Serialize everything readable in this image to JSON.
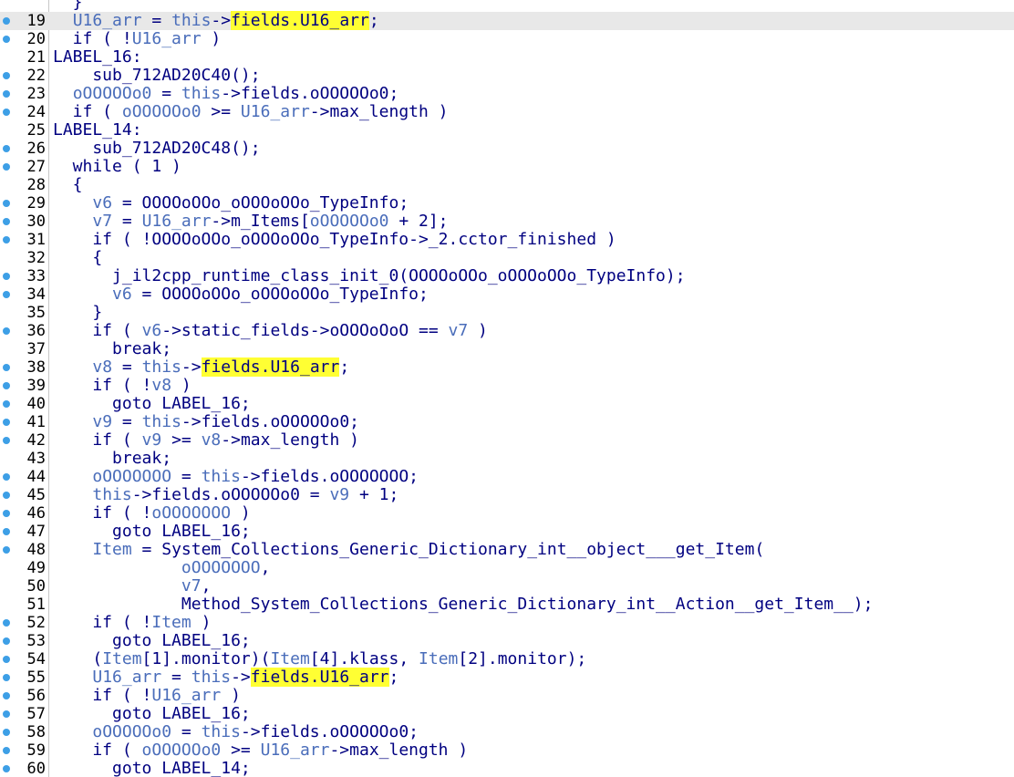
{
  "editor": {
    "lines": [
      {
        "n": "",
        "bp": false,
        "current": false,
        "tokens": [
          {
            "t": "  }",
            "c": ""
          }
        ]
      },
      {
        "n": "19",
        "bp": true,
        "current": true,
        "tokens": [
          {
            "t": "  ",
            "c": ""
          },
          {
            "t": "U16_arr",
            "c": "var"
          },
          {
            "t": " = ",
            "c": ""
          },
          {
            "t": "this",
            "c": "var"
          },
          {
            "t": "->",
            "c": ""
          },
          {
            "t": "fields.U16_",
            "c": "hl"
          },
          {
            "t": "|",
            "c": "cursor"
          },
          {
            "t": "arr",
            "c": "hl"
          },
          {
            "t": ";",
            "c": ""
          }
        ]
      },
      {
        "n": "20",
        "bp": true,
        "current": false,
        "tokens": [
          {
            "t": "  if ( !",
            "c": ""
          },
          {
            "t": "U16_arr",
            "c": "var"
          },
          {
            "t": " )",
            "c": ""
          }
        ]
      },
      {
        "n": "21",
        "bp": false,
        "current": false,
        "tokens": [
          {
            "t": "LABEL_16:",
            "c": ""
          }
        ]
      },
      {
        "n": "22",
        "bp": true,
        "current": false,
        "tokens": [
          {
            "t": "    sub_712AD20C40();",
            "c": ""
          }
        ]
      },
      {
        "n": "23",
        "bp": true,
        "current": false,
        "tokens": [
          {
            "t": "  ",
            "c": ""
          },
          {
            "t": "oOOOOOo0",
            "c": "var"
          },
          {
            "t": " = ",
            "c": ""
          },
          {
            "t": "this",
            "c": "var"
          },
          {
            "t": "->fields.oOOOOOo0;",
            "c": ""
          }
        ]
      },
      {
        "n": "24",
        "bp": true,
        "current": false,
        "tokens": [
          {
            "t": "  if ( ",
            "c": ""
          },
          {
            "t": "oOOOOOo0",
            "c": "var"
          },
          {
            "t": " >= ",
            "c": ""
          },
          {
            "t": "U16_arr",
            "c": "var"
          },
          {
            "t": "->max_length )",
            "c": ""
          }
        ]
      },
      {
        "n": "25",
        "bp": false,
        "current": false,
        "tokens": [
          {
            "t": "LABEL_14:",
            "c": ""
          }
        ]
      },
      {
        "n": "26",
        "bp": true,
        "current": false,
        "tokens": [
          {
            "t": "    sub_712AD20C48();",
            "c": ""
          }
        ]
      },
      {
        "n": "27",
        "bp": true,
        "current": false,
        "tokens": [
          {
            "t": "  while ( 1 )",
            "c": ""
          }
        ]
      },
      {
        "n": "28",
        "bp": false,
        "current": false,
        "tokens": [
          {
            "t": "  {",
            "c": ""
          }
        ]
      },
      {
        "n": "29",
        "bp": true,
        "current": false,
        "tokens": [
          {
            "t": "    ",
            "c": ""
          },
          {
            "t": "v6",
            "c": "var"
          },
          {
            "t": " = OOOOoOOo_oOOOoOOo_TypeInfo;",
            "c": ""
          }
        ]
      },
      {
        "n": "30",
        "bp": true,
        "current": false,
        "tokens": [
          {
            "t": "    ",
            "c": ""
          },
          {
            "t": "v7",
            "c": "var"
          },
          {
            "t": " = ",
            "c": ""
          },
          {
            "t": "U16_arr",
            "c": "var"
          },
          {
            "t": "->m_Items[",
            "c": ""
          },
          {
            "t": "oOOOOOo0",
            "c": "var"
          },
          {
            "t": " + 2];",
            "c": ""
          }
        ]
      },
      {
        "n": "31",
        "bp": true,
        "current": false,
        "tokens": [
          {
            "t": "    if ( !OOOOoOOo_oOOOoOOo_TypeInfo->_2.cctor_finished )",
            "c": ""
          }
        ]
      },
      {
        "n": "32",
        "bp": false,
        "current": false,
        "tokens": [
          {
            "t": "    {",
            "c": ""
          }
        ]
      },
      {
        "n": "33",
        "bp": true,
        "current": false,
        "tokens": [
          {
            "t": "      j_il2cpp_runtime_class_init_0(OOOOoOOo_oOOOoOOo_TypeInfo);",
            "c": ""
          }
        ]
      },
      {
        "n": "34",
        "bp": true,
        "current": false,
        "tokens": [
          {
            "t": "      ",
            "c": ""
          },
          {
            "t": "v6",
            "c": "var"
          },
          {
            "t": " = OOOOoOOo_oOOOoOOo_TypeInfo;",
            "c": ""
          }
        ]
      },
      {
        "n": "35",
        "bp": false,
        "current": false,
        "tokens": [
          {
            "t": "    }",
            "c": ""
          }
        ]
      },
      {
        "n": "36",
        "bp": true,
        "current": false,
        "tokens": [
          {
            "t": "    if ( ",
            "c": ""
          },
          {
            "t": "v6",
            "c": "var"
          },
          {
            "t": "->static_fields->oOOOoOoO == ",
            "c": ""
          },
          {
            "t": "v7",
            "c": "var"
          },
          {
            "t": " )",
            "c": ""
          }
        ]
      },
      {
        "n": "37",
        "bp": false,
        "current": false,
        "tokens": [
          {
            "t": "      break;",
            "c": ""
          }
        ]
      },
      {
        "n": "38",
        "bp": true,
        "current": false,
        "tokens": [
          {
            "t": "    ",
            "c": ""
          },
          {
            "t": "v8",
            "c": "var"
          },
          {
            "t": " = ",
            "c": ""
          },
          {
            "t": "this",
            "c": "var"
          },
          {
            "t": "->",
            "c": ""
          },
          {
            "t": "fields.U16_arr",
            "c": "hl"
          },
          {
            "t": ";",
            "c": ""
          }
        ]
      },
      {
        "n": "39",
        "bp": true,
        "current": false,
        "tokens": [
          {
            "t": "    if ( !",
            "c": ""
          },
          {
            "t": "v8",
            "c": "var"
          },
          {
            "t": " )",
            "c": ""
          }
        ]
      },
      {
        "n": "40",
        "bp": true,
        "current": false,
        "tokens": [
          {
            "t": "      goto LABEL_16;",
            "c": ""
          }
        ]
      },
      {
        "n": "41",
        "bp": true,
        "current": false,
        "tokens": [
          {
            "t": "    ",
            "c": ""
          },
          {
            "t": "v9",
            "c": "var"
          },
          {
            "t": " = ",
            "c": ""
          },
          {
            "t": "this",
            "c": "var"
          },
          {
            "t": "->fields.oOOOOOo0;",
            "c": ""
          }
        ]
      },
      {
        "n": "42",
        "bp": true,
        "current": false,
        "tokens": [
          {
            "t": "    if ( ",
            "c": ""
          },
          {
            "t": "v9",
            "c": "var"
          },
          {
            "t": " >= ",
            "c": ""
          },
          {
            "t": "v8",
            "c": "var"
          },
          {
            "t": "->max_length )",
            "c": ""
          }
        ]
      },
      {
        "n": "43",
        "bp": false,
        "current": false,
        "tokens": [
          {
            "t": "      break;",
            "c": ""
          }
        ]
      },
      {
        "n": "44",
        "bp": true,
        "current": false,
        "tokens": [
          {
            "t": "    ",
            "c": ""
          },
          {
            "t": "oOOOOOOO",
            "c": "var"
          },
          {
            "t": " = ",
            "c": ""
          },
          {
            "t": "this",
            "c": "var"
          },
          {
            "t": "->fields.oOOOOOOO;",
            "c": ""
          }
        ]
      },
      {
        "n": "45",
        "bp": true,
        "current": false,
        "tokens": [
          {
            "t": "    ",
            "c": ""
          },
          {
            "t": "this",
            "c": "var"
          },
          {
            "t": "->fields.oOOOOOo0 = ",
            "c": ""
          },
          {
            "t": "v9",
            "c": "var"
          },
          {
            "t": " + 1;",
            "c": ""
          }
        ]
      },
      {
        "n": "46",
        "bp": true,
        "current": false,
        "tokens": [
          {
            "t": "    if ( !",
            "c": ""
          },
          {
            "t": "oOOOOOOO",
            "c": "var"
          },
          {
            "t": " )",
            "c": ""
          }
        ]
      },
      {
        "n": "47",
        "bp": true,
        "current": false,
        "tokens": [
          {
            "t": "      goto LABEL_16;",
            "c": ""
          }
        ]
      },
      {
        "n": "48",
        "bp": true,
        "current": false,
        "tokens": [
          {
            "t": "    ",
            "c": ""
          },
          {
            "t": "Item",
            "c": "var"
          },
          {
            "t": " = System_Collections_Generic_Dictionary_int__object___get_Item(",
            "c": ""
          }
        ]
      },
      {
        "n": "49",
        "bp": false,
        "current": false,
        "tokens": [
          {
            "t": "             ",
            "c": ""
          },
          {
            "t": "oOOOOOOO",
            "c": "var"
          },
          {
            "t": ",",
            "c": ""
          }
        ]
      },
      {
        "n": "50",
        "bp": false,
        "current": false,
        "tokens": [
          {
            "t": "             ",
            "c": ""
          },
          {
            "t": "v7",
            "c": "var"
          },
          {
            "t": ",",
            "c": ""
          }
        ]
      },
      {
        "n": "51",
        "bp": false,
        "current": false,
        "tokens": [
          {
            "t": "             Method_System_Collections_Generic_Dictionary_int__Action__get_Item__);",
            "c": ""
          }
        ]
      },
      {
        "n": "52",
        "bp": true,
        "current": false,
        "tokens": [
          {
            "t": "    if ( !",
            "c": ""
          },
          {
            "t": "Item",
            "c": "var"
          },
          {
            "t": " )",
            "c": ""
          }
        ]
      },
      {
        "n": "53",
        "bp": true,
        "current": false,
        "tokens": [
          {
            "t": "      goto LABEL_16;",
            "c": ""
          }
        ]
      },
      {
        "n": "54",
        "bp": true,
        "current": false,
        "tokens": [
          {
            "t": "    (",
            "c": ""
          },
          {
            "t": "Item",
            "c": "var"
          },
          {
            "t": "[1].monitor)(",
            "c": ""
          },
          {
            "t": "Item",
            "c": "var"
          },
          {
            "t": "[4].klass, ",
            "c": ""
          },
          {
            "t": "Item",
            "c": "var"
          },
          {
            "t": "[2].monitor);",
            "c": ""
          }
        ]
      },
      {
        "n": "55",
        "bp": true,
        "current": false,
        "tokens": [
          {
            "t": "    ",
            "c": ""
          },
          {
            "t": "U16_arr",
            "c": "var"
          },
          {
            "t": " = ",
            "c": ""
          },
          {
            "t": "this",
            "c": "var"
          },
          {
            "t": "->",
            "c": ""
          },
          {
            "t": "fields.U16_arr",
            "c": "hl"
          },
          {
            "t": ";",
            "c": ""
          }
        ]
      },
      {
        "n": "56",
        "bp": true,
        "current": false,
        "tokens": [
          {
            "t": "    if ( !",
            "c": ""
          },
          {
            "t": "U16_arr",
            "c": "var"
          },
          {
            "t": " )",
            "c": ""
          }
        ]
      },
      {
        "n": "57",
        "bp": true,
        "current": false,
        "tokens": [
          {
            "t": "      goto LABEL_16;",
            "c": ""
          }
        ]
      },
      {
        "n": "58",
        "bp": true,
        "current": false,
        "tokens": [
          {
            "t": "    ",
            "c": ""
          },
          {
            "t": "oOOOOOo0",
            "c": "var"
          },
          {
            "t": " = ",
            "c": ""
          },
          {
            "t": "this",
            "c": "var"
          },
          {
            "t": "->fields.oOOOOOo0;",
            "c": ""
          }
        ]
      },
      {
        "n": "59",
        "bp": true,
        "current": false,
        "tokens": [
          {
            "t": "    if ( ",
            "c": ""
          },
          {
            "t": "oOOOOOo0",
            "c": "var"
          },
          {
            "t": " >= ",
            "c": ""
          },
          {
            "t": "U16_arr",
            "c": "var"
          },
          {
            "t": "->max_length )",
            "c": ""
          }
        ]
      },
      {
        "n": "60",
        "bp": true,
        "current": false,
        "tokens": [
          {
            "t": "      goto LABEL_14;",
            "c": ""
          }
        ]
      },
      {
        "n": "",
        "bp": false,
        "current": false,
        "tokens": [
          {
            "t": "  }",
            "c": ""
          }
        ]
      }
    ]
  },
  "colors": {
    "text": "#000080",
    "variable": "#4a6dba",
    "highlight": "#ffff33",
    "current_line": "#e8e8e8",
    "breakpoint_dot": "#3d9fe6"
  }
}
